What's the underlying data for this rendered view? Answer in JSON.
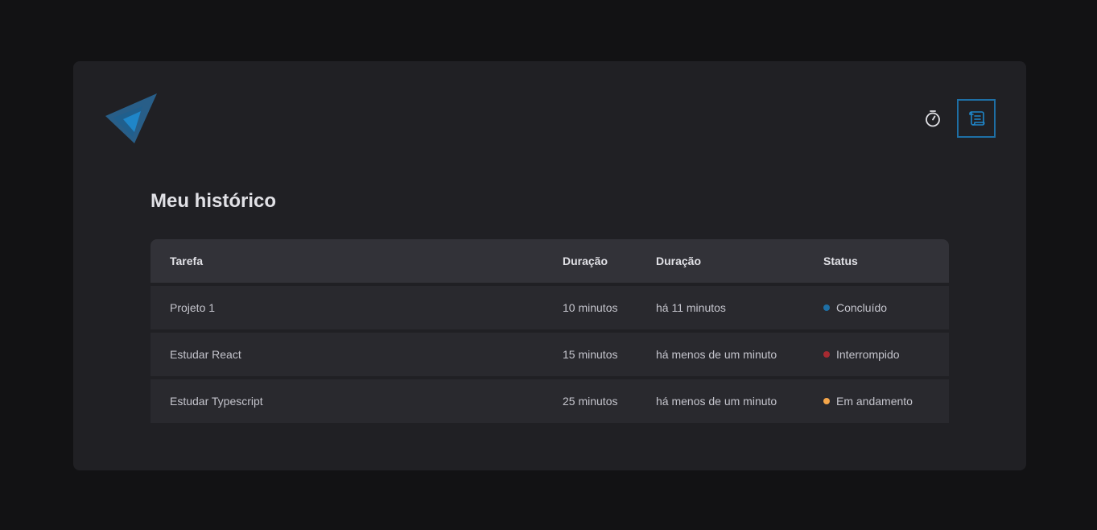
{
  "page": {
    "title": "Meu histórico"
  },
  "nav": {
    "items": [
      {
        "icon": "timer-icon",
        "active": false
      },
      {
        "icon": "scroll-icon",
        "active": true
      }
    ]
  },
  "colors": {
    "background": "#121214",
    "card": "#202024",
    "accent": "#1e6fa5",
    "status_done": "#1e6fa5",
    "status_interrupted": "#a62a31",
    "status_progress": "#f5a64a"
  },
  "table": {
    "headers": [
      "Tarefa",
      "Duração",
      "Duração",
      "Status"
    ],
    "rows": [
      {
        "task": "Projeto 1",
        "duration": "10 minutos",
        "started": "há 11 minutos",
        "status": "Concluído",
        "status_color": "#1e6fa5"
      },
      {
        "task": "Estudar React",
        "duration": "15 minutos",
        "started": "há menos de um minuto",
        "status": "Interrompido",
        "status_color": "#a62a31"
      },
      {
        "task": "Estudar Typescript",
        "duration": "25 minutos",
        "started": "há menos de um minuto",
        "status": "Em andamento",
        "status_color": "#f5a64a"
      }
    ]
  }
}
